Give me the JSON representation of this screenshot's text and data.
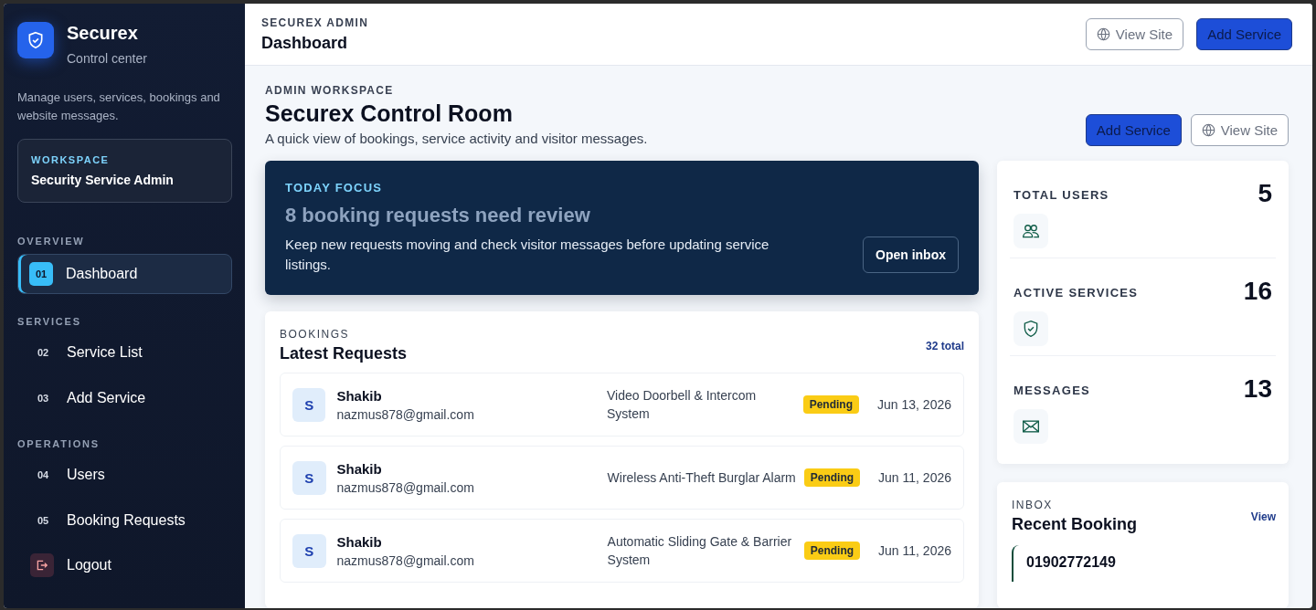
{
  "brand": {
    "name": "Securex",
    "tagline": "Control center",
    "description": "Manage users, services, bookings and website messages."
  },
  "workspace": {
    "label": "WORKSPACE",
    "name": "Security Service Admin"
  },
  "nav_sections": [
    {
      "title": "OVERVIEW",
      "items": [
        {
          "number": "01",
          "label": "Dashboard",
          "selected": true
        }
      ]
    },
    {
      "title": "SERVICES",
      "items": [
        {
          "number": "02",
          "label": "Service List",
          "selected": false
        },
        {
          "number": "03",
          "label": "Add Service",
          "selected": false
        }
      ]
    },
    {
      "title": "OPERATIONS",
      "items": [
        {
          "number": "04",
          "label": "Users",
          "selected": false
        },
        {
          "number": "05",
          "label": "Booking Requests",
          "selected": false
        }
      ]
    }
  ],
  "logout": {
    "label": "Logout"
  },
  "topbar": {
    "eyebrow": "SECUREX ADMIN",
    "title": "Dashboard",
    "buttons": [
      {
        "kind": "outline",
        "label": "View Site"
      },
      {
        "kind": "primary",
        "label": "Add Service"
      }
    ]
  },
  "hero": {
    "eyebrow": "ADMIN WORKSPACE",
    "title": "Securex Control Room",
    "subtitle": "A quick view of bookings, service activity and visitor messages.",
    "buttons": [
      {
        "kind": "primary",
        "label": "Add Service"
      },
      {
        "kind": "outline",
        "label": "View Site"
      }
    ]
  },
  "focus": {
    "eyebrow": "TODAY FOCUS",
    "title": "8 booking requests need review",
    "text": "Keep new requests moving and check visitor messages before updating service listings.",
    "button": "Open inbox"
  },
  "bookings": {
    "eyebrow": "BOOKINGS",
    "title": "Latest Requests",
    "total": "32 total",
    "rows": [
      {
        "initial": "S",
        "name": "Shakib",
        "email": "nazmus878@gmail.com",
        "service": "Video Doorbell & Intercom System",
        "status": "Pending",
        "date": "Jun 13, 2026"
      },
      {
        "initial": "S",
        "name": "Shakib",
        "email": "nazmus878@gmail.com",
        "service": "Wireless Anti-Theft Burglar Alarm",
        "status": "Pending",
        "date": "Jun 11, 2026"
      },
      {
        "initial": "S",
        "name": "Shakib",
        "email": "nazmus878@gmail.com",
        "service": "Automatic Sliding Gate & Barrier System",
        "status": "Pending",
        "date": "Jun 11, 2026"
      }
    ]
  },
  "stats": [
    {
      "kind": "users",
      "label": "TOTAL USERS",
      "value": "5"
    },
    {
      "kind": "shield",
      "label": "ACTIVE SERVICES",
      "value": "16"
    },
    {
      "kind": "mail",
      "label": "MESSAGES",
      "value": "13"
    }
  ],
  "inbox": {
    "eyebrow": "INBOX",
    "title": "Recent Booking",
    "link": "View",
    "items": [
      {
        "phone": "01902772149"
      }
    ]
  }
}
